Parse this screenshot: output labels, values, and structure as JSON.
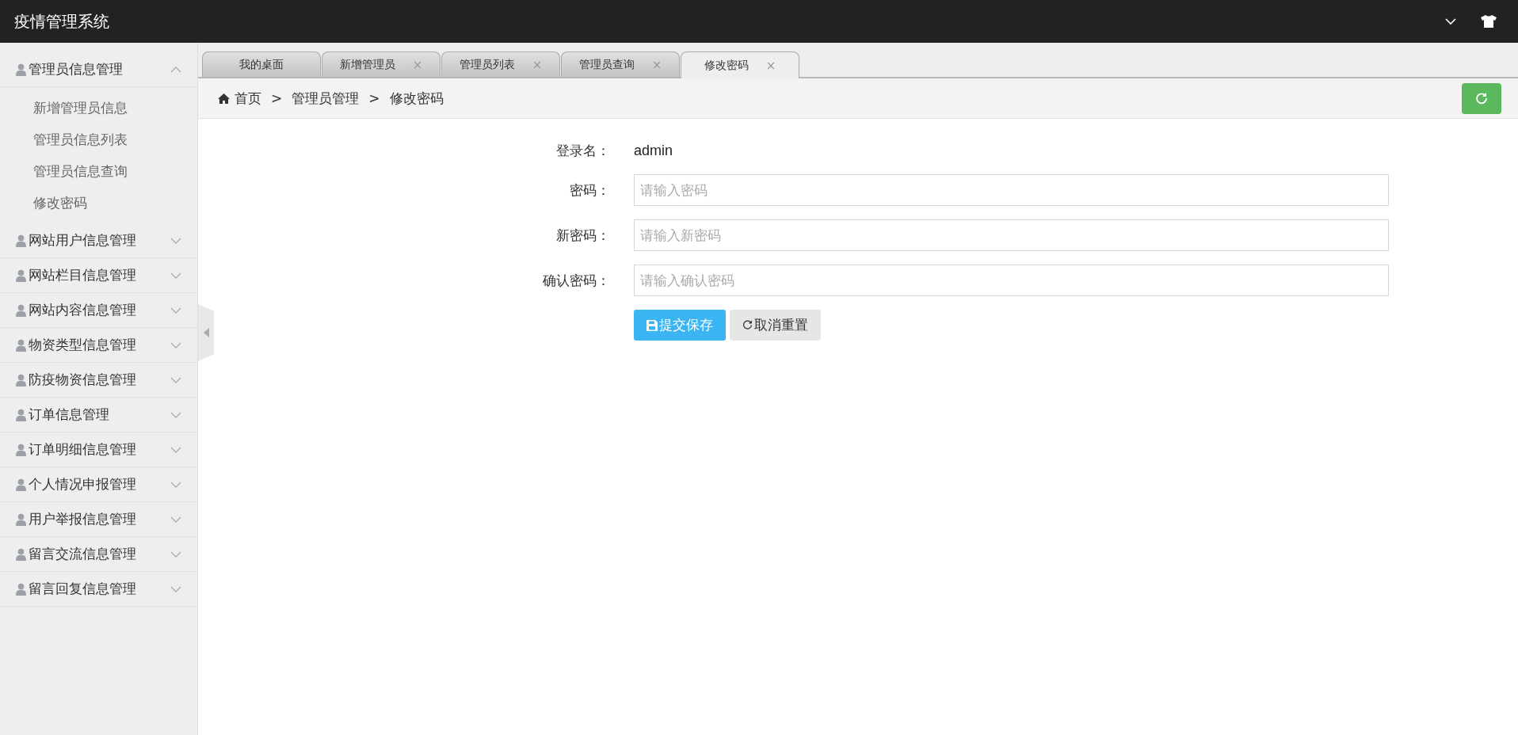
{
  "header": {
    "title": "疫情管理系统"
  },
  "sidebar": {
    "groups": [
      {
        "label": "管理员信息管理",
        "expanded": true,
        "children": [
          {
            "label": "新增管理员信息"
          },
          {
            "label": "管理员信息列表"
          },
          {
            "label": "管理员信息查询"
          },
          {
            "label": "修改密码"
          }
        ]
      },
      {
        "label": "网站用户信息管理",
        "expanded": false
      },
      {
        "label": "网站栏目信息管理",
        "expanded": false
      },
      {
        "label": "网站内容信息管理",
        "expanded": false
      },
      {
        "label": "物资类型信息管理",
        "expanded": false
      },
      {
        "label": "防疫物资信息管理",
        "expanded": false
      },
      {
        "label": "订单信息管理",
        "expanded": false
      },
      {
        "label": "订单明细信息管理",
        "expanded": false
      },
      {
        "label": "个人情况申报管理",
        "expanded": false
      },
      {
        "label": "用户举报信息管理",
        "expanded": false
      },
      {
        "label": "留言交流信息管理",
        "expanded": false
      },
      {
        "label": "留言回复信息管理",
        "expanded": false
      }
    ]
  },
  "tabs": [
    {
      "label": "我的桌面",
      "selected": false
    },
    {
      "label": "新增管理员",
      "close": "×",
      "selected": false
    },
    {
      "label": "管理员列表",
      "close": "×",
      "selected": false
    },
    {
      "label": "管理员查询",
      "close": "×",
      "selected": false
    },
    {
      "label": "修改密码",
      "close": "×",
      "selected": true
    }
  ],
  "breadcrumb": {
    "items": [
      "首页",
      "管理员管理",
      "修改密码"
    ],
    "separators": [
      ">",
      ">"
    ]
  },
  "form": {
    "fields": [
      {
        "kind": "text",
        "label": "登录名：",
        "value": "admin"
      },
      {
        "kind": "input",
        "label": "密码：",
        "placeholder": "请输入密码"
      },
      {
        "kind": "input",
        "label": "新密码：",
        "placeholder": "请输入新密码"
      },
      {
        "kind": "input",
        "label": "确认密码：",
        "placeholder": "请输入确认密码"
      }
    ],
    "buttons": [
      {
        "kind": "primary",
        "label": "提交保存"
      },
      {
        "kind": "default",
        "label": "取消重置"
      }
    ]
  }
}
